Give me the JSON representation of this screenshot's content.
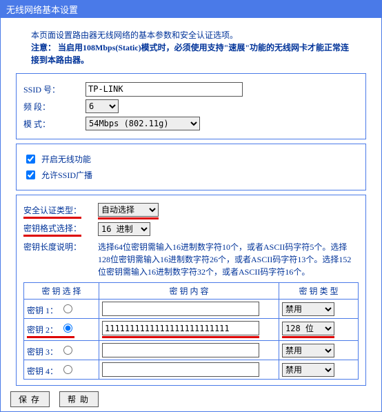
{
  "title": "无线网络基本设置",
  "intro_line1": "本页面设置路由器无线网络的基本参数和安全认证选项。",
  "intro_warn_label": "注意：",
  "intro_warn_text": "当启用108Mbps(Static)模式时，必须使用支持\"速展\"功能的无线网卡才能正常连接到本路由器。",
  "basic": {
    "ssid_label": "SSID 号：",
    "ssid_value": "TP-LINK",
    "band_label": "频 段：",
    "band_value": "6",
    "mode_label": "模 式：",
    "mode_value": "54Mbps (802.11g)"
  },
  "toggles": {
    "enable_wireless": "开启无线功能",
    "allow_ssid_broadcast": "允许SSID广播"
  },
  "security": {
    "auth_label": "安全认证类型：",
    "auth_value": "自动选择",
    "keyfmt_label": "密钥格式选择：",
    "keyfmt_value": "16 进制",
    "keylen_label": "密钥长度说明：",
    "keylen_desc": "选择64位密钥需输入16进制数字符10个，或者ASCII码字符5个。选择128位密钥需输入16进制数字符26个，或者ASCII码字符13个。选择152位密钥需输入16进制数字符32个，或者ASCII码字符16个。"
  },
  "key_table": {
    "hdr_select": "密 钥 选 择",
    "hdr_content": "密 钥 内 容",
    "hdr_type": "密 钥 类 型",
    "rows": [
      {
        "label": "密钥 1：",
        "value": "",
        "type": "禁用",
        "selected": false
      },
      {
        "label": "密钥 2：",
        "value": "1111111111111111111111111",
        "type": "128 位",
        "selected": true
      },
      {
        "label": "密钥 3：",
        "value": "",
        "type": "禁用",
        "selected": false
      },
      {
        "label": "密钥 4：",
        "value": "",
        "type": "禁用",
        "selected": false
      }
    ]
  },
  "buttons": {
    "save": "保存",
    "help": "帮助"
  }
}
